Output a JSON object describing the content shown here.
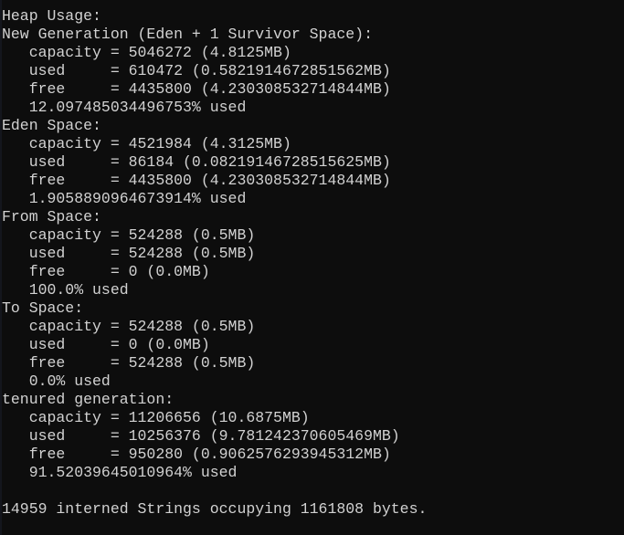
{
  "terminal": {
    "colors": {
      "background": "#0d0d0d",
      "foreground": "#d2d2d2",
      "edge_strip": "#14161d"
    },
    "lines": [
      "Heap Usage:",
      "New Generation (Eden + 1 Survivor Space):",
      "   capacity = 5046272 (4.8125MB)",
      "   used     = 610472 (0.5821914672851562MB)",
      "   free     = 4435800 (4.230308532714844MB)",
      "   12.097485034496753% used",
      "Eden Space:",
      "   capacity = 4521984 (4.3125MB)",
      "   used     = 86184 (0.08219146728515625MB)",
      "   free     = 4435800 (4.230308532714844MB)",
      "   1.9058890964673914% used",
      "From Space:",
      "   capacity = 524288 (0.5MB)",
      "   used     = 524288 (0.5MB)",
      "   free     = 0 (0.0MB)",
      "   100.0% used",
      "To Space:",
      "   capacity = 524288 (0.5MB)",
      "   used     = 0 (0.0MB)",
      "   free     = 524288 (0.5MB)",
      "   0.0% used",
      "tenured generation:",
      "   capacity = 11206656 (10.6875MB)",
      "   used     = 10256376 (9.781242370605469MB)",
      "   free     = 950280 (0.9062576293945312MB)",
      "   91.52039645010964% used",
      "",
      "14959 interned Strings occupying 1161808 bytes."
    ],
    "heap_usage": {
      "header": "Heap Usage:",
      "regions": [
        {
          "name": "New Generation (Eden + 1 Survivor Space):",
          "capacity_label": "capacity",
          "capacity_bytes": "5046272",
          "capacity_mb": "4.8125MB",
          "used_label": "used",
          "used_bytes": "610472",
          "used_mb": "0.5821914672851562MB",
          "free_label": "free",
          "free_bytes": "4435800",
          "free_mb": "4.230308532714844MB",
          "percent_used": "12.097485034496753% used"
        },
        {
          "name": "Eden Space:",
          "capacity_label": "capacity",
          "capacity_bytes": "4521984",
          "capacity_mb": "4.3125MB",
          "used_label": "used",
          "used_bytes": "86184",
          "used_mb": "0.08219146728515625MB",
          "free_label": "free",
          "free_bytes": "4435800",
          "free_mb": "4.230308532714844MB",
          "percent_used": "1.9058890964673914% used"
        },
        {
          "name": "From Space:",
          "capacity_label": "capacity",
          "capacity_bytes": "524288",
          "capacity_mb": "0.5MB",
          "used_label": "used",
          "used_bytes": "524288",
          "used_mb": "0.5MB",
          "free_label": "free",
          "free_bytes": "0",
          "free_mb": "0.0MB",
          "percent_used": "100.0% used"
        },
        {
          "name": "To Space:",
          "capacity_label": "capacity",
          "capacity_bytes": "524288",
          "capacity_mb": "0.5MB",
          "used_label": "used",
          "used_bytes": "0",
          "used_mb": "0.0MB",
          "free_label": "free",
          "free_bytes": "524288",
          "free_mb": "0.5MB",
          "percent_used": "0.0% used"
        },
        {
          "name": "tenured generation:",
          "capacity_label": "capacity",
          "capacity_bytes": "11206656",
          "capacity_mb": "10.6875MB",
          "used_label": "used",
          "used_bytes": "10256376",
          "used_mb": "9.781242370605469MB",
          "free_label": "free",
          "free_bytes": "950280",
          "free_mb": "0.9062576293945312MB",
          "percent_used": "91.52039645010964% used"
        }
      ],
      "interned_strings": {
        "count": "14959",
        "bytes": "1161808",
        "text": "14959 interned Strings occupying 1161808 bytes."
      }
    }
  }
}
